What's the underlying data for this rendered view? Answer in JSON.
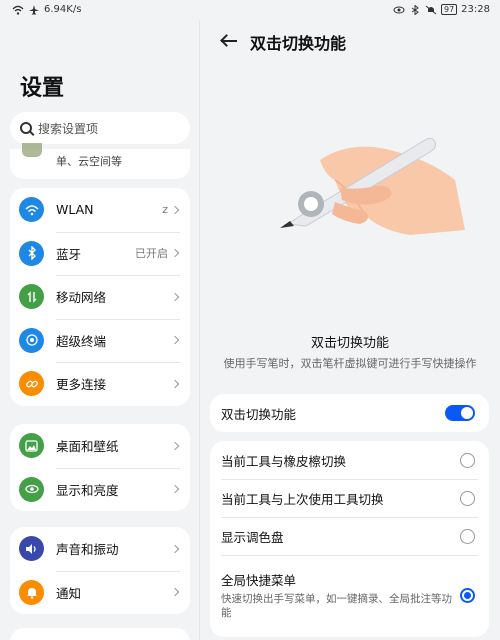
{
  "status": {
    "speed": "6.94K/s",
    "battery": "97",
    "time": "23:28"
  },
  "left": {
    "title": "设置",
    "search_placeholder": "搜索设置项",
    "account_fragment": "单、云空间等",
    "groups": [
      [
        {
          "label": "WLAN",
          "value": "z",
          "icon": "wifi-icon",
          "color": "#1e88e5"
        },
        {
          "label": "蓝牙",
          "value": "已开启",
          "icon": "bluetooth-icon",
          "color": "#1e88e5"
        },
        {
          "label": "移动网络",
          "value": "",
          "icon": "mobile-network-icon",
          "color": "#43a047"
        },
        {
          "label": "超级终端",
          "value": "",
          "icon": "super-device-icon",
          "color": "#1e88e5"
        },
        {
          "label": "更多连接",
          "value": "",
          "icon": "link-icon",
          "color": "#fb8c00"
        }
      ],
      [
        {
          "label": "桌面和壁纸",
          "value": "",
          "icon": "wallpaper-icon",
          "color": "#43a047"
        },
        {
          "label": "显示和亮度",
          "value": "",
          "icon": "eye-icon",
          "color": "#43a047"
        }
      ],
      [
        {
          "label": "声音和振动",
          "value": "",
          "icon": "sound-icon",
          "color": "#3949ab"
        },
        {
          "label": "通知",
          "value": "",
          "icon": "bell-icon",
          "color": "#fb8c00"
        }
      ]
    ]
  },
  "right": {
    "title": "双击切换功能",
    "feature_title": "双击切换功能",
    "feature_desc": "使用手写笔时，双击笔杆虚拟键可进行手写快捷操作",
    "toggle_label": "双击切换功能",
    "toggle_on": true,
    "options": [
      {
        "label": "当前工具与橡皮檫切换",
        "sub": "",
        "selected": false
      },
      {
        "label": "当前工具与上次使用工具切换",
        "sub": "",
        "selected": false
      },
      {
        "label": "显示调色盘",
        "sub": "",
        "selected": false
      },
      {
        "label": "全局快捷菜单",
        "sub": "快速切换出手写菜单，如一键摘录、全局批注等功能",
        "selected": true
      }
    ]
  },
  "colors": {
    "accent": "#0a59f7",
    "background": "#f1f3f5"
  }
}
